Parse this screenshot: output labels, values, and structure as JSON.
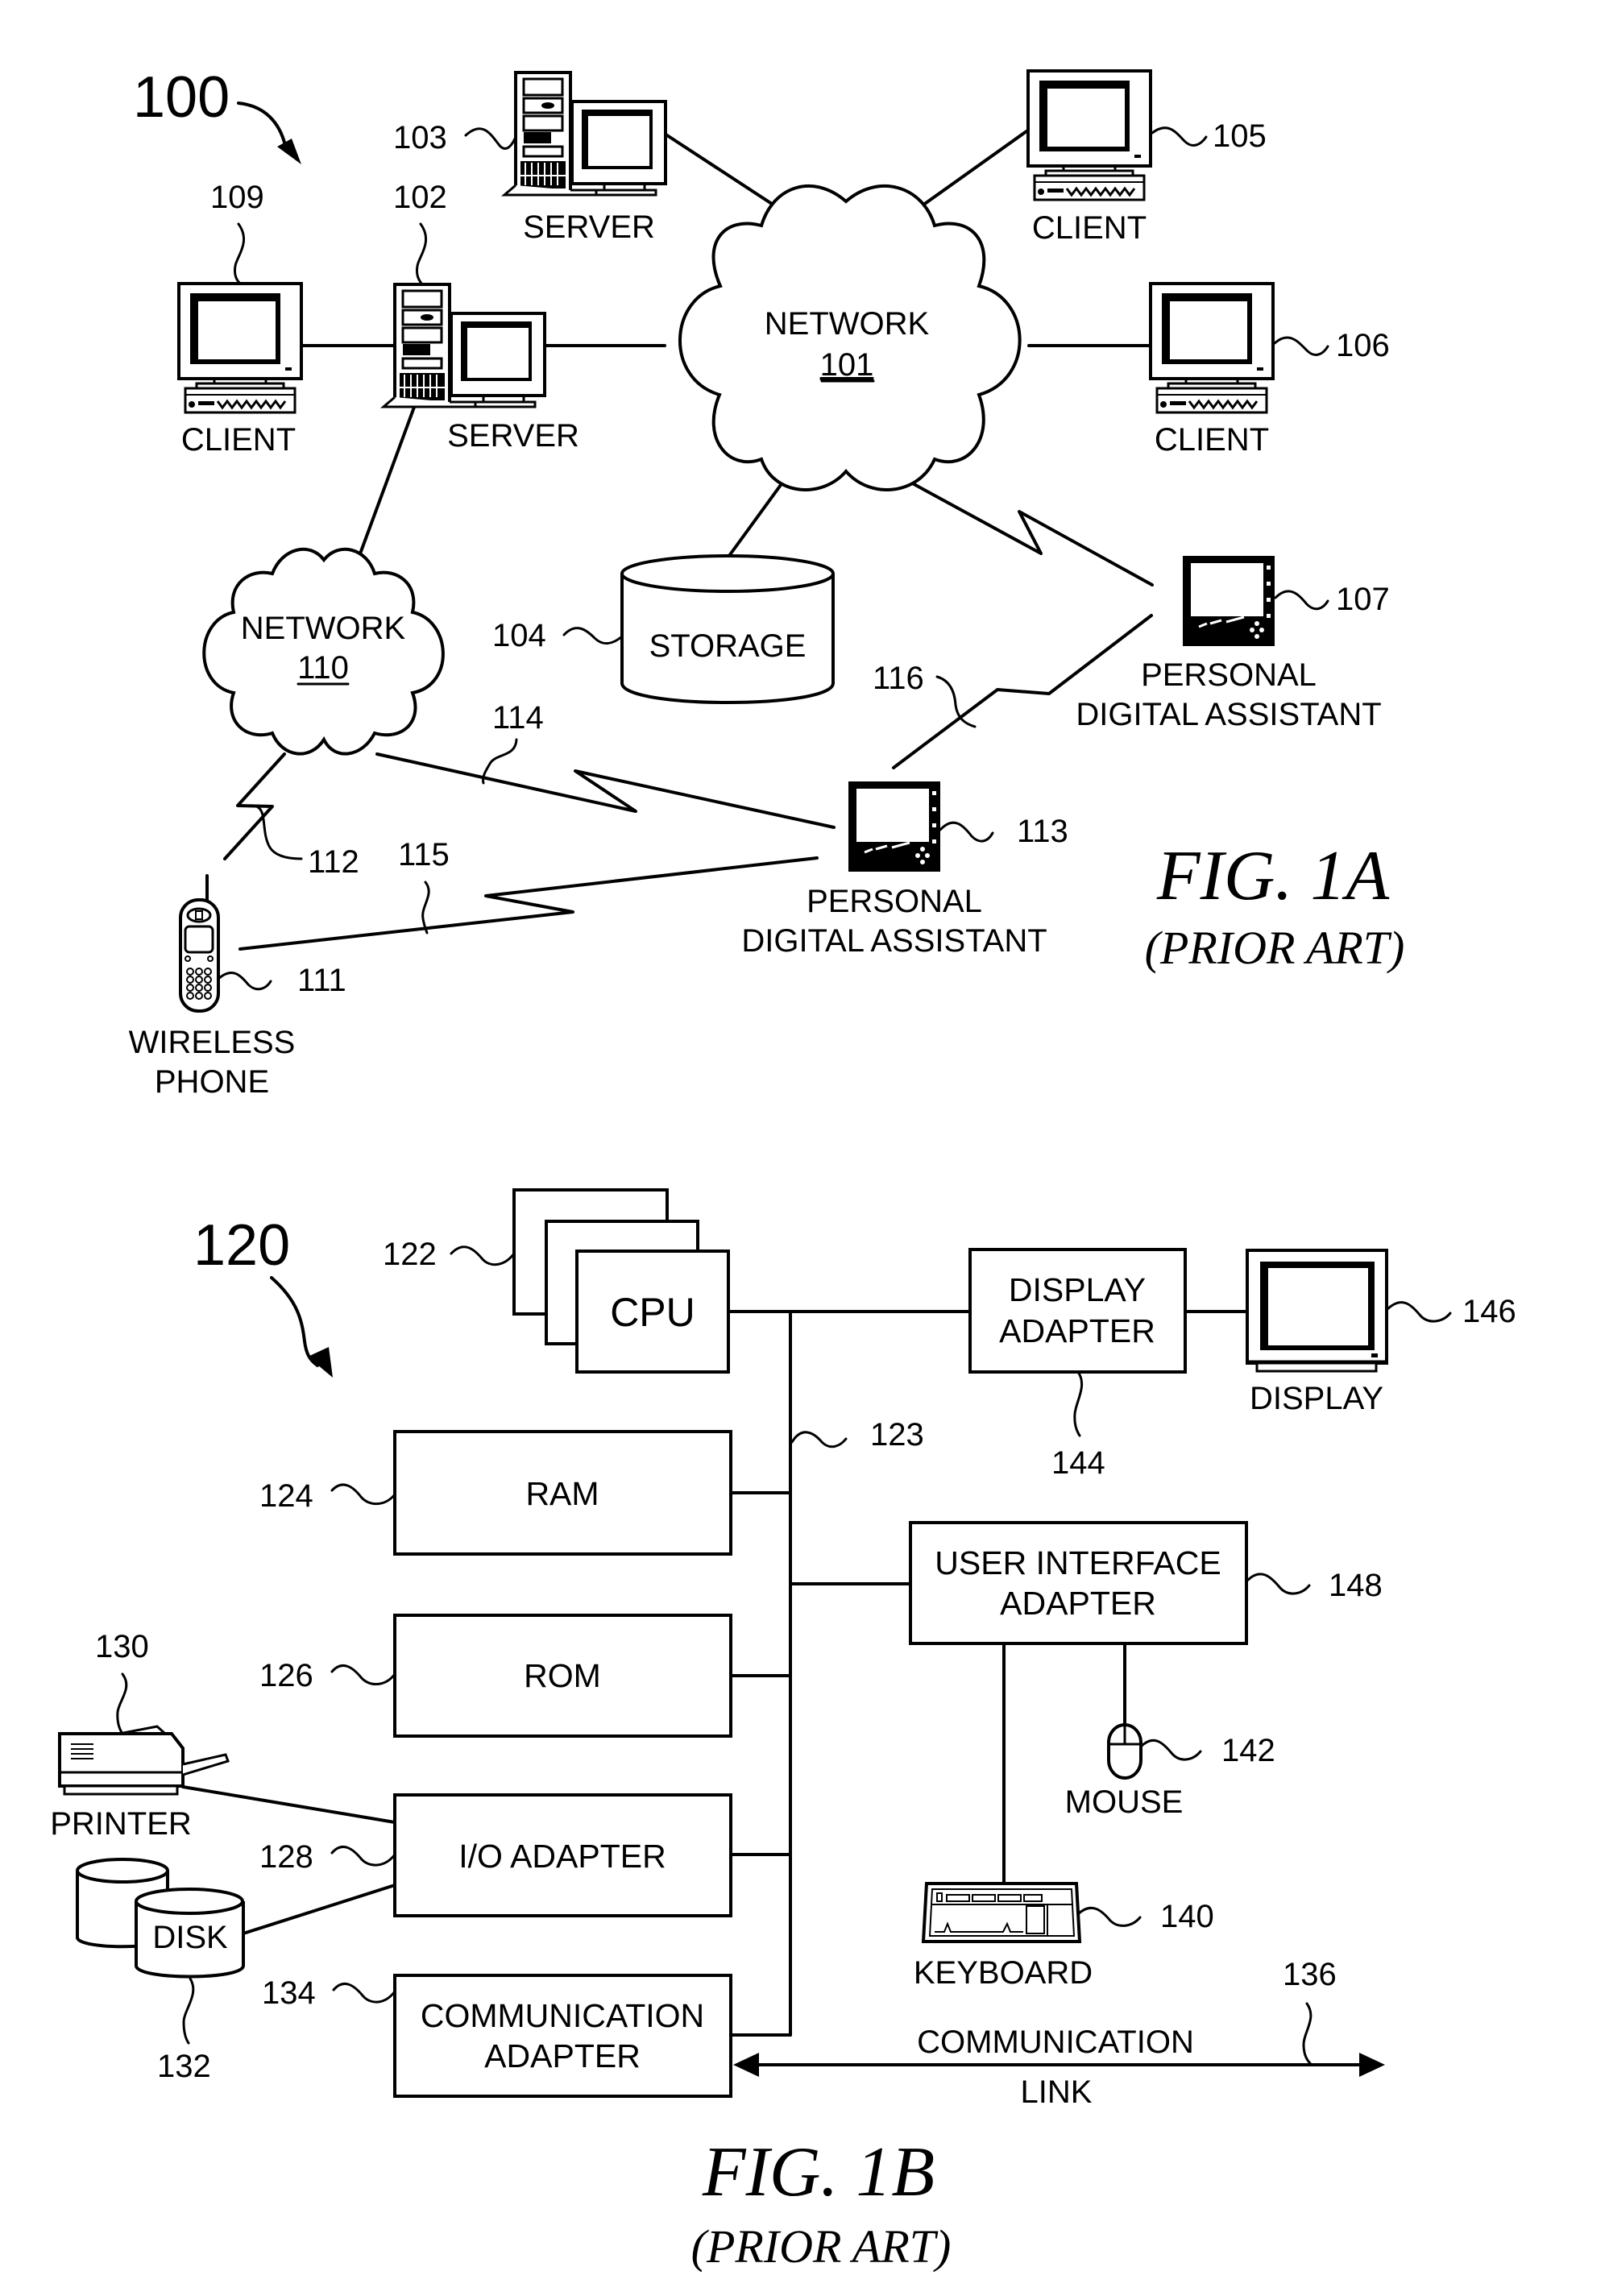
{
  "figure_1a": {
    "reference": "100",
    "caption": "FIG. 1A",
    "subcaption": "(PRIOR ART)",
    "network_101": {
      "label": "NETWORK",
      "ref": "101"
    },
    "network_110": {
      "label": "NETWORK",
      "ref": "110"
    },
    "server_103": {
      "label": "SERVER",
      "ref": "103"
    },
    "server_102": {
      "label": "SERVER",
      "ref": "102"
    },
    "client_109": {
      "label": "CLIENT",
      "ref": "109"
    },
    "client_105": {
      "label": "CLIENT",
      "ref": "105"
    },
    "client_106": {
      "label": "CLIENT",
      "ref": "106"
    },
    "storage_104": {
      "label": "STORAGE",
      "ref": "104"
    },
    "pda_107": {
      "label_line1": "PERSONAL",
      "label_line2": "DIGITAL ASSISTANT",
      "ref": "107"
    },
    "pda_113": {
      "label_line1": "PERSONAL",
      "label_line2": "DIGITAL ASSISTANT",
      "ref": "113"
    },
    "phone_111": {
      "label_line1": "WIRELESS",
      "label_line2": "PHONE",
      "ref": "111"
    },
    "link_112": {
      "ref": "112"
    },
    "link_114": {
      "ref": "114"
    },
    "link_115": {
      "ref": "115"
    },
    "link_116": {
      "ref": "116"
    }
  },
  "figure_1b": {
    "reference": "120",
    "caption": "FIG. 1B",
    "subcaption": "(PRIOR ART)",
    "cpu": {
      "label": "CPU",
      "ref": "122"
    },
    "bus": {
      "ref": "123"
    },
    "ram": {
      "label": "RAM",
      "ref": "124"
    },
    "rom": {
      "label": "ROM",
      "ref": "126"
    },
    "io_adapter": {
      "label": "I/O ADAPTER",
      "ref": "128"
    },
    "comm_adapter": {
      "label_line1": "COMMUNICATION",
      "label_line2": "ADAPTER",
      "ref": "134"
    },
    "printer": {
      "label": "PRINTER",
      "ref": "130"
    },
    "disk": {
      "label": "DISK",
      "ref": "132"
    },
    "display_adapter": {
      "label_line1": "DISPLAY",
      "label_line2": "ADAPTER",
      "ref": "144"
    },
    "display": {
      "label": "DISPLAY",
      "ref": "146"
    },
    "ui_adapter": {
      "label_line1": "USER INTERFACE",
      "label_line2": "ADAPTER",
      "ref": "148"
    },
    "mouse": {
      "label": "MOUSE",
      "ref": "142"
    },
    "keyboard": {
      "label": "KEYBOARD",
      "ref": "140"
    },
    "comm_link": {
      "label_line1": "COMMUNICATION",
      "label_line2": "LINK",
      "ref": "136"
    }
  }
}
